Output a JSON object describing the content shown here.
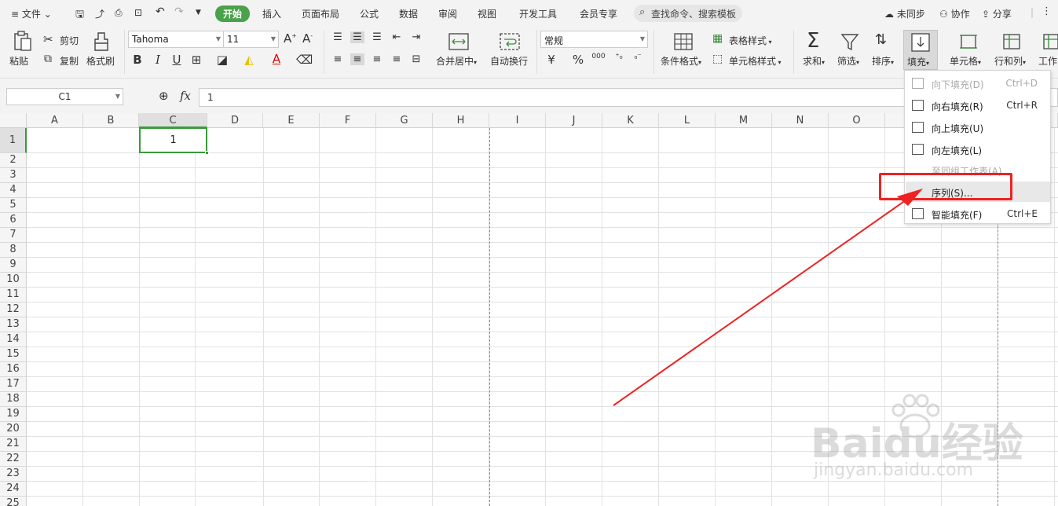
{
  "menubar": {
    "file": "文件",
    "tabs": [
      "开始",
      "插入",
      "页面布局",
      "公式",
      "数据",
      "审阅",
      "视图",
      "开发工具",
      "会员专享"
    ],
    "search": "查找命令、搜索模板",
    "sync": "未同步",
    "collab": "协作",
    "share": "分享"
  },
  "ribbon": {
    "paste": "粘贴",
    "cut": "剪切",
    "copy": "复制",
    "format_painter": "格式刷",
    "font_name": "Tahoma",
    "font_size": "11",
    "bold": "B",
    "italic": "I",
    "underline": "U",
    "merge_center": "合并居中",
    "wrap_text": "自动换行",
    "number_format": "常规",
    "currency": "¥",
    "percent": "%",
    "thousands": "000",
    "conditional_format": "条件格式",
    "table_style": "表格样式",
    "cell_style": "单元格样式",
    "sum": "求和",
    "filter": "筛选",
    "sort": "排序",
    "fill": "填充",
    "cells": "单元格",
    "rows_cols": "行和列",
    "worksheet": "工作"
  },
  "formula_bar": {
    "name_box": "C1",
    "fx": "fx",
    "value": "1"
  },
  "grid": {
    "columns": [
      "A",
      "B",
      "C",
      "D",
      "E",
      "F",
      "G",
      "H",
      "I",
      "J",
      "K",
      "L",
      "M",
      "N",
      "O"
    ],
    "rows": [
      "1",
      "2",
      "3",
      "4",
      "5",
      "6",
      "7",
      "8",
      "9",
      "10",
      "11",
      "12",
      "13",
      "14",
      "15",
      "16",
      "17",
      "18",
      "19",
      "20",
      "21",
      "22",
      "23",
      "24",
      "25"
    ],
    "active_cell_value": "1"
  },
  "fill_menu": {
    "items": [
      {
        "label": "向下填充(D)",
        "shortcut": "Ctrl+D",
        "disabled": true
      },
      {
        "label": "向右填充(R)",
        "shortcut": "Ctrl+R",
        "disabled": false
      },
      {
        "label": "向上填充(U)",
        "shortcut": "",
        "disabled": false
      },
      {
        "label": "向左填充(L)",
        "shortcut": "",
        "disabled": false
      },
      {
        "label": "至同组工作表(A)...",
        "shortcut": "",
        "disabled": true
      },
      {
        "label": "序列(S)...",
        "shortcut": "",
        "disabled": false
      },
      {
        "label": "智能填充(F)",
        "shortcut": "Ctrl+E",
        "disabled": false
      }
    ]
  },
  "annotation": {
    "highlight_color": "#ee2222",
    "arrow_color": "#ee2222"
  },
  "watermark": {
    "text": "Baidu经验",
    "subtext": "jingyan.baidu.com"
  }
}
